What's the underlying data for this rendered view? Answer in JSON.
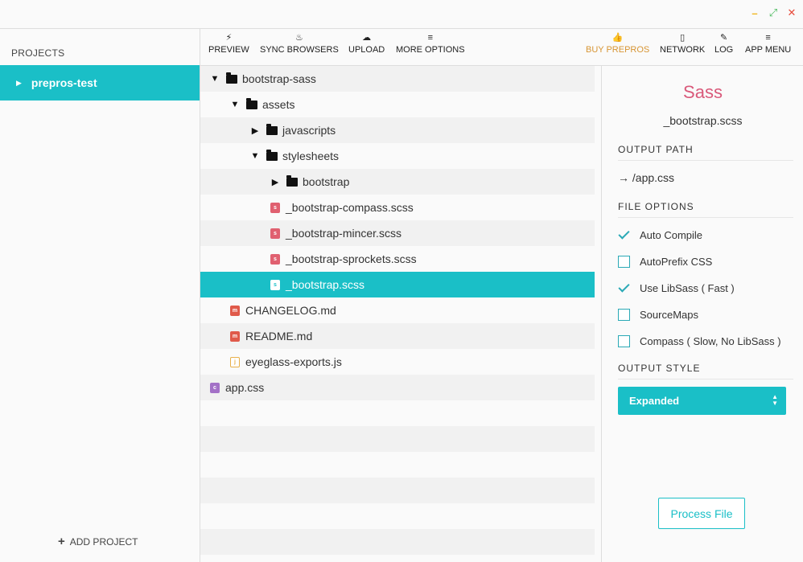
{
  "window": {
    "minimize_icon": "–",
    "maximize_icon": "⤢",
    "close_icon": "✕"
  },
  "sidebar": {
    "title": "PROJECTS",
    "projects": [
      {
        "label": "prepros-test",
        "selected": true
      }
    ],
    "add_label": "ADD PROJECT",
    "add_icon": "+"
  },
  "toolbar": {
    "left": [
      {
        "label": "PREVIEW",
        "icon": "bolt-icon",
        "glyph": "⚡"
      },
      {
        "label": "SYNC BROWSERS",
        "icon": "flame-icon",
        "glyph": "♨"
      },
      {
        "label": "UPLOAD",
        "icon": "cloud-upload-icon",
        "glyph": "☁"
      },
      {
        "label": "MORE OPTIONS",
        "icon": "menu-icon",
        "glyph": "≡"
      }
    ],
    "right": [
      {
        "label": "BUY PREPROS",
        "icon": "thumbs-up-icon",
        "glyph": "👍"
      },
      {
        "label": "NETWORK",
        "icon": "mobile-icon",
        "glyph": "▯"
      },
      {
        "label": "LOG",
        "icon": "feather-icon",
        "glyph": "✎"
      },
      {
        "label": "APP MENU",
        "icon": "menu-icon",
        "glyph": "≡"
      }
    ]
  },
  "tree": [
    {
      "label": "bootstrap-sass",
      "type": "folder",
      "expanded": true,
      "depth": 0
    },
    {
      "label": "assets",
      "type": "folder",
      "expanded": true,
      "depth": 1
    },
    {
      "label": "javascripts",
      "type": "folder",
      "expanded": false,
      "depth": 2
    },
    {
      "label": "stylesheets",
      "type": "folder",
      "expanded": true,
      "depth": 2
    },
    {
      "label": "bootstrap",
      "type": "folder",
      "expanded": false,
      "depth": 3
    },
    {
      "label": "_bootstrap-compass.scss",
      "type": "scss",
      "depth": 3
    },
    {
      "label": "_bootstrap-mincer.scss",
      "type": "scss",
      "depth": 3
    },
    {
      "label": "_bootstrap-sprockets.scss",
      "type": "scss",
      "depth": 3
    },
    {
      "label": "_bootstrap.scss",
      "type": "scss",
      "depth": 3,
      "selected": true
    },
    {
      "label": "CHANGELOG.md",
      "type": "md",
      "depth": 1
    },
    {
      "label": "README.md",
      "type": "md",
      "depth": 1
    },
    {
      "label": "eyeglass-exports.js",
      "type": "js",
      "depth": 1
    },
    {
      "label": "app.css",
      "type": "css",
      "depth": 0
    }
  ],
  "panel": {
    "title": "Sass",
    "filename": "_bootstrap.scss",
    "output_path_heading": "OUTPUT PATH",
    "output_path": "→ /app.css",
    "file_options_heading": "FILE OPTIONS",
    "options": [
      {
        "label": "Auto Compile",
        "checked": true
      },
      {
        "label": "AutoPrefix CSS",
        "checked": false
      },
      {
        "label": "Use LibSass ( Fast )",
        "checked": true
      },
      {
        "label": "SourceMaps",
        "checked": false
      },
      {
        "label": "Compass ( Slow, No LibSass )",
        "checked": false
      }
    ],
    "output_style_heading": "OUTPUT STYLE",
    "output_style": "Expanded",
    "process_label": "Process File"
  },
  "colors": {
    "accent": "#1abfc7",
    "sass_title": "#d9597a",
    "buy": "#d79534"
  }
}
